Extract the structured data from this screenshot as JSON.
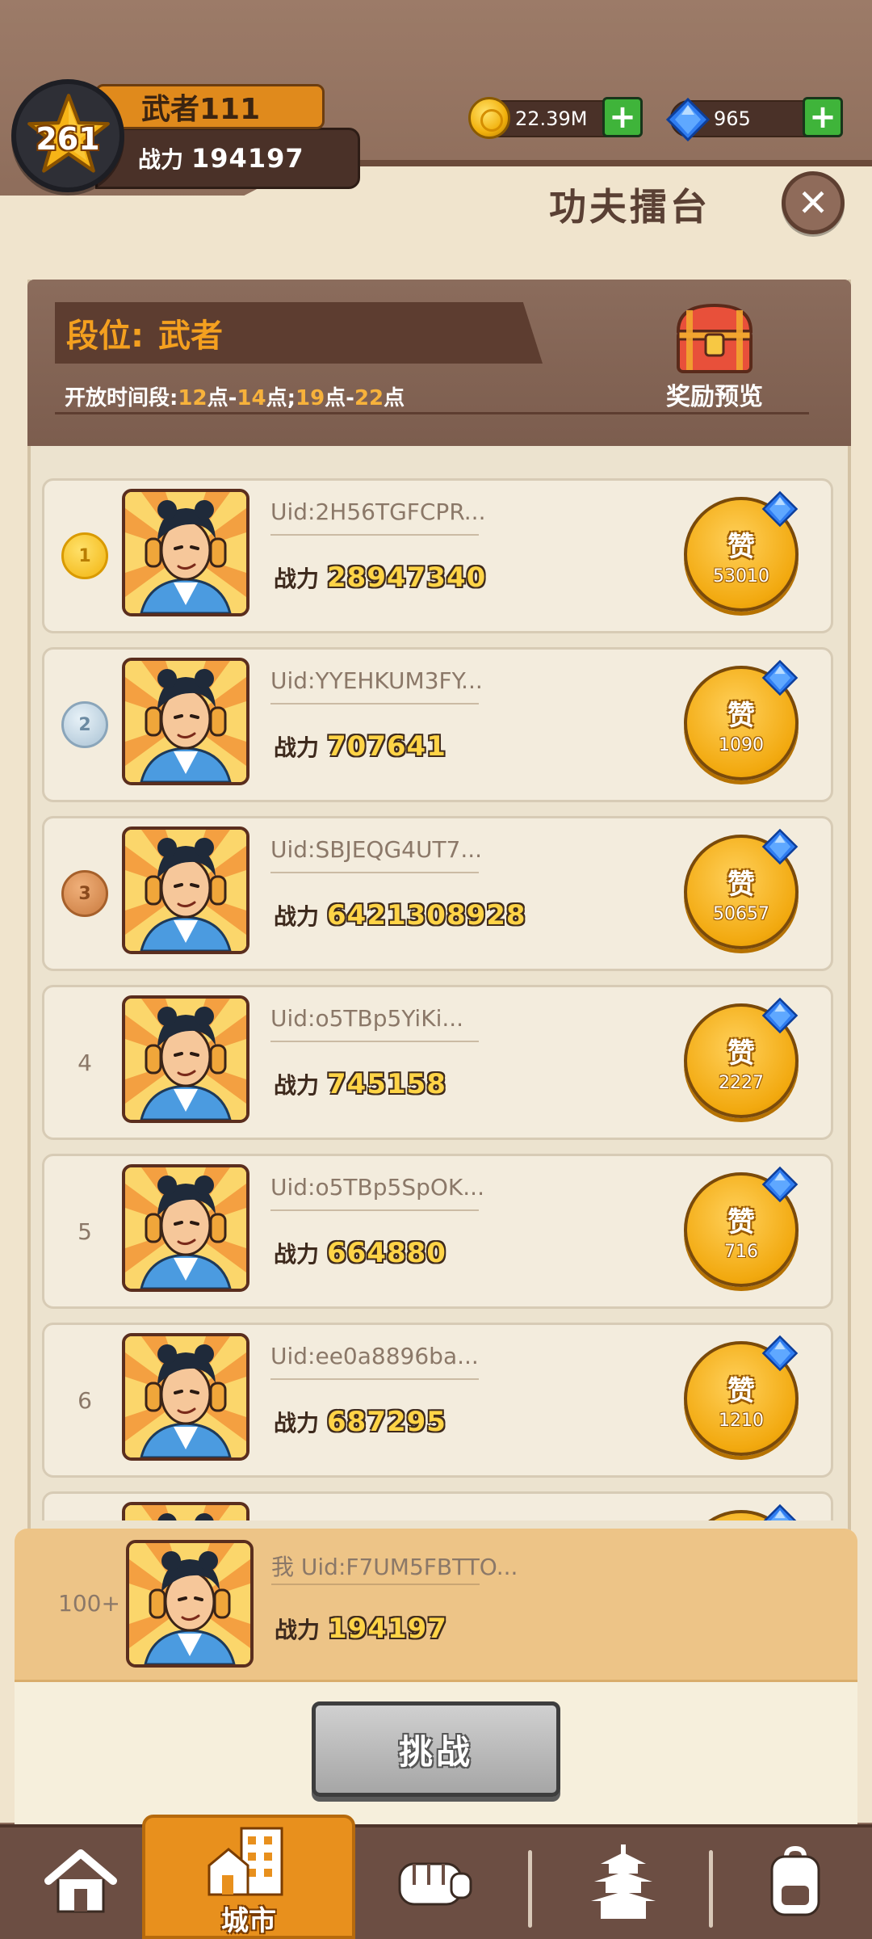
{
  "player": {
    "level": "261",
    "name": "武者111",
    "power_label": "战力",
    "power_value": "194197"
  },
  "resources": {
    "gold": "22.39M",
    "gems": "965",
    "plus": "+"
  },
  "header": {
    "title": "功夫擂台",
    "close": "✕"
  },
  "rank_info": {
    "label": "段位:",
    "value": "武者",
    "time_prefix": "开放时间段:",
    "t1": "12",
    "t_point1": "点-",
    "t2": "14",
    "t_point2": "点;",
    "t3": "19",
    "t_point3": "点-",
    "t4": "22",
    "t_point4": "点",
    "reward_label": "奖励预览"
  },
  "leaderboard": {
    "power_label": "战力",
    "like_label": "赞",
    "rows": [
      {
        "rank": "1",
        "uid": "Uid:2H56TGFCPR...",
        "power": "28947340",
        "likes": "53010"
      },
      {
        "rank": "2",
        "uid": "Uid:YYEHKUM3FY...",
        "power": "707641",
        "likes": "1090"
      },
      {
        "rank": "3",
        "uid": "Uid:SBJEQG4UT7...",
        "power": "6421308928",
        "likes": "50657"
      },
      {
        "rank": "4",
        "uid": "Uid:o5TBp5YiKi...",
        "power": "745158",
        "likes": "2227"
      },
      {
        "rank": "5",
        "uid": "Uid:o5TBp5SpOK...",
        "power": "664880",
        "likes": "716"
      },
      {
        "rank": "6",
        "uid": "Uid:ee0a8896ba...",
        "power": "687295",
        "likes": "1210"
      }
    ]
  },
  "me": {
    "rank": "100+",
    "uid": "我 Uid:F7UM5FBTTO...",
    "power_label": "战力",
    "power": "194197"
  },
  "challenge_label": "挑战",
  "nav": {
    "active_label": "城市",
    "items": [
      "home-icon",
      "city-icon",
      "fist-icon",
      "pagoda-icon",
      "backpack-icon"
    ]
  },
  "colors": {
    "accent_orange": "#e8901d",
    "panel_cream": "#f0e4cd",
    "brown_dark": "#5d3d30",
    "gold_text": "#ffd447"
  }
}
